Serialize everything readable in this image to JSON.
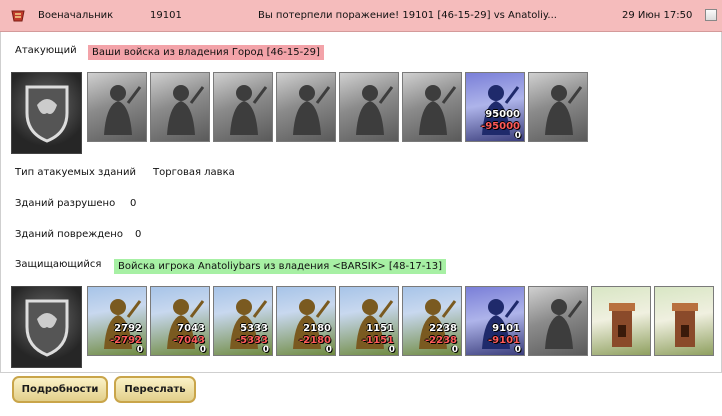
{
  "header": {
    "role": "Военачальник",
    "id": "19101",
    "message": "Вы потерпели поражение! 19101 [46-15-29] vs Anatoliy...",
    "datetime": "29 Июн 17:50"
  },
  "attacker": {
    "label": "Атакующий",
    "source": "Ваши войска из владения Город [46-15-29]",
    "units": [
      {
        "kind": "gray"
      },
      {
        "kind": "gray"
      },
      {
        "kind": "gray"
      },
      {
        "kind": "gray"
      },
      {
        "kind": "gray"
      },
      {
        "kind": "gray"
      },
      {
        "kind": "purple",
        "count": "95000",
        "loss": "-95000",
        "remain": "0"
      },
      {
        "kind": "gray"
      }
    ]
  },
  "buildings": {
    "type_label": "Тип атакуемых зданий",
    "type_value": "Торговая лавка",
    "destroyed_label": "Зданий разрушено",
    "destroyed_value": "0",
    "damaged_label": "Зданий повреждено",
    "damaged_value": "0"
  },
  "defender": {
    "label": "Защищающийся",
    "source": "Войска игрока Anatoliybars из владения <BARSIK> [48-17-13]",
    "units": [
      {
        "kind": "color",
        "count": "2792",
        "loss": "-2792",
        "remain": "0"
      },
      {
        "kind": "color",
        "count": "7043",
        "loss": "-7043",
        "remain": "0"
      },
      {
        "kind": "color",
        "count": "5333",
        "loss": "-5333",
        "remain": "0"
      },
      {
        "kind": "color",
        "count": "2180",
        "loss": "-2180",
        "remain": "0"
      },
      {
        "kind": "color",
        "count": "1151",
        "loss": "-1151",
        "remain": "0"
      },
      {
        "kind": "color",
        "count": "2238",
        "loss": "-2238",
        "remain": "0"
      },
      {
        "kind": "purple",
        "count": "9101",
        "loss": "-9101",
        "remain": "0"
      },
      {
        "kind": "gray"
      },
      {
        "kind": "tower"
      },
      {
        "kind": "tower"
      }
    ]
  },
  "buttons": {
    "details": "Подробности",
    "forward": "Переслать"
  },
  "colors": {
    "header_bg": "#f5bcbc",
    "attacker_highlight": "#f3a3a9",
    "defender_highlight": "#a7f0a4",
    "loss_text": "#ff5a5a"
  }
}
